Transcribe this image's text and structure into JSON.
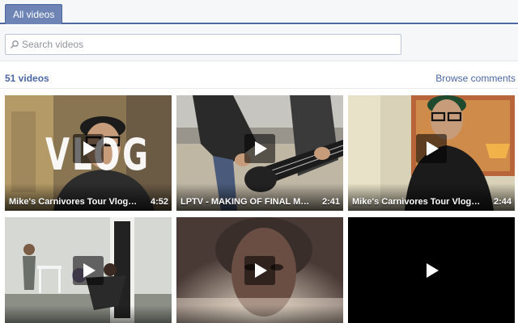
{
  "tabs": {
    "all_videos": "All videos"
  },
  "search": {
    "placeholder": "Search videos",
    "value": ""
  },
  "header": {
    "count": "51 videos",
    "browse": "Browse comments"
  },
  "videos": [
    {
      "title": "Mike's Carnivores Tour Vlog #2",
      "duration": "4:52",
      "overlay": "VLOG"
    },
    {
      "title": "LPTV - MAKING OF FINAL MASQUE...",
      "duration": "2:41"
    },
    {
      "title": "Mike's Carnivores Tour Vlog #1",
      "duration": "2:44"
    },
    {
      "title": "",
      "duration": ""
    },
    {
      "title": "",
      "duration": ""
    },
    {
      "title": "",
      "duration": ""
    }
  ]
}
